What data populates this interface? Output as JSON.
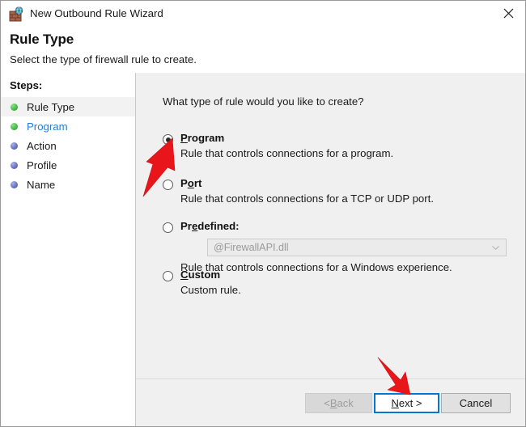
{
  "window": {
    "title": "New Outbound Rule Wizard",
    "icon": "firewall-globe-icon",
    "close_label": "Close"
  },
  "header": {
    "title": "Rule Type",
    "subtitle": "Select the type of firewall rule to create."
  },
  "sidebar": {
    "label": "Steps:",
    "items": [
      {
        "label": "Rule Type",
        "state": "done",
        "current": true,
        "link": false
      },
      {
        "label": "Program",
        "state": "done",
        "current": false,
        "link": true
      },
      {
        "label": "Action",
        "state": "pending",
        "current": false,
        "link": false
      },
      {
        "label": "Profile",
        "state": "pending",
        "current": false,
        "link": false
      },
      {
        "label": "Name",
        "state": "pending",
        "current": false,
        "link": false
      }
    ]
  },
  "main": {
    "question": "What type of rule would you like to create?",
    "options": [
      {
        "label": "Program",
        "accel_index": 0,
        "description": "Rule that controls connections for a program.",
        "selected": true
      },
      {
        "label": "Port",
        "accel_index": 1,
        "description": "Rule that controls connections for a TCP or UDP port.",
        "selected": false
      },
      {
        "label": "Predefined:",
        "accel_index": 2,
        "description": "Rule that controls connections for a Windows experience.",
        "selected": false,
        "combo": {
          "value": "@FirewallAPI.dll",
          "disabled": true,
          "arrow_icon": "chevron-down-icon"
        }
      },
      {
        "label": "Custom",
        "accel_index": 0,
        "description": "Custom rule.",
        "selected": false
      }
    ]
  },
  "footer": {
    "buttons": [
      {
        "id": "back",
        "label": "< Back",
        "accel_char": "B",
        "state": "disabled"
      },
      {
        "id": "next",
        "label": "Next >",
        "accel_char": "N",
        "state": "default"
      },
      {
        "id": "cancel",
        "label": "Cancel",
        "accel_char": "",
        "state": "normal"
      }
    ]
  },
  "annotations": {
    "color": "#e8151a",
    "arrows": [
      {
        "name": "arrow-pointing-to-program-radio",
        "target": "program-radio"
      },
      {
        "name": "arrow-pointing-to-next-button",
        "target": "next-button"
      }
    ]
  }
}
